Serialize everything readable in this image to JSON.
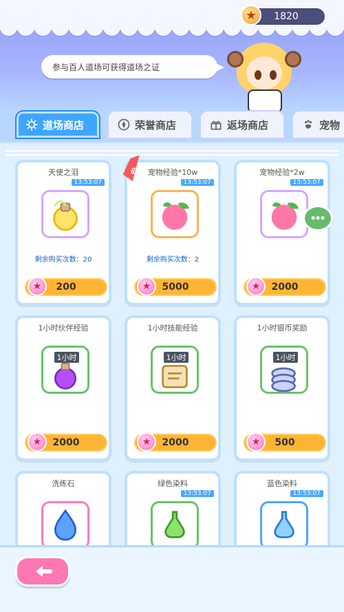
{
  "header": {
    "currency_value": "1820",
    "speech": "参与百人道场可获得道场之证"
  },
  "tabs": [
    {
      "label": "道场商店",
      "active": true,
      "icon": "gear-icon"
    },
    {
      "label": "荣誉商店",
      "active": false,
      "icon": "compass-icon"
    },
    {
      "label": "返场商店",
      "active": false,
      "icon": "gift-icon"
    },
    {
      "label": "宠物",
      "active": false,
      "icon": "paw-icon"
    }
  ],
  "items": [
    {
      "title": "天使之泪",
      "time": "13:53:07",
      "remain": "剩余购买次数：20",
      "price": "200",
      "icon": "angel-tear-bottle-icon",
      "badge": "",
      "ribbon": ""
    },
    {
      "title": "宠物经验*10w",
      "time": "13:53:07",
      "remain": "剩余购买次数：2",
      "price": "5000",
      "icon": "peach-icon",
      "badge": "",
      "ribbon": "必买"
    },
    {
      "title": "宠物经验*2w",
      "time": "13:53:07",
      "remain": "",
      "price": "2000",
      "icon": "peach-icon",
      "badge": "",
      "ribbon": ""
    },
    {
      "title": "1小时伙伴经验",
      "time": "",
      "remain": "",
      "price": "2000",
      "icon": "potion-flask-icon",
      "badge": "1小时",
      "ribbon": ""
    },
    {
      "title": "1小时技能经验",
      "time": "",
      "remain": "",
      "price": "2000",
      "icon": "scroll-icon",
      "badge": "1小时",
      "ribbon": ""
    },
    {
      "title": "1小时银币奖励",
      "time": "",
      "remain": "",
      "price": "500",
      "icon": "silver-coins-icon",
      "badge": "1小时",
      "ribbon": ""
    },
    {
      "title": "洗练石",
      "time": "",
      "remain": "",
      "price": "",
      "icon": "blue-gem-drop-icon",
      "badge": "",
      "ribbon": ""
    },
    {
      "title": "绿色染料",
      "time": "13:53:07",
      "remain": "",
      "price": "",
      "icon": "green-dye-bottle-icon",
      "badge": "",
      "ribbon": ""
    },
    {
      "title": "蓝色染料",
      "time": "13:53:07",
      "remain": "",
      "price": "",
      "icon": "blue-dye-bottle-icon",
      "badge": "",
      "ribbon": ""
    }
  ],
  "colors": {
    "tab_active": "#3fa6ff",
    "price_button": "#ffb533",
    "back_button": "#ff77b3"
  }
}
